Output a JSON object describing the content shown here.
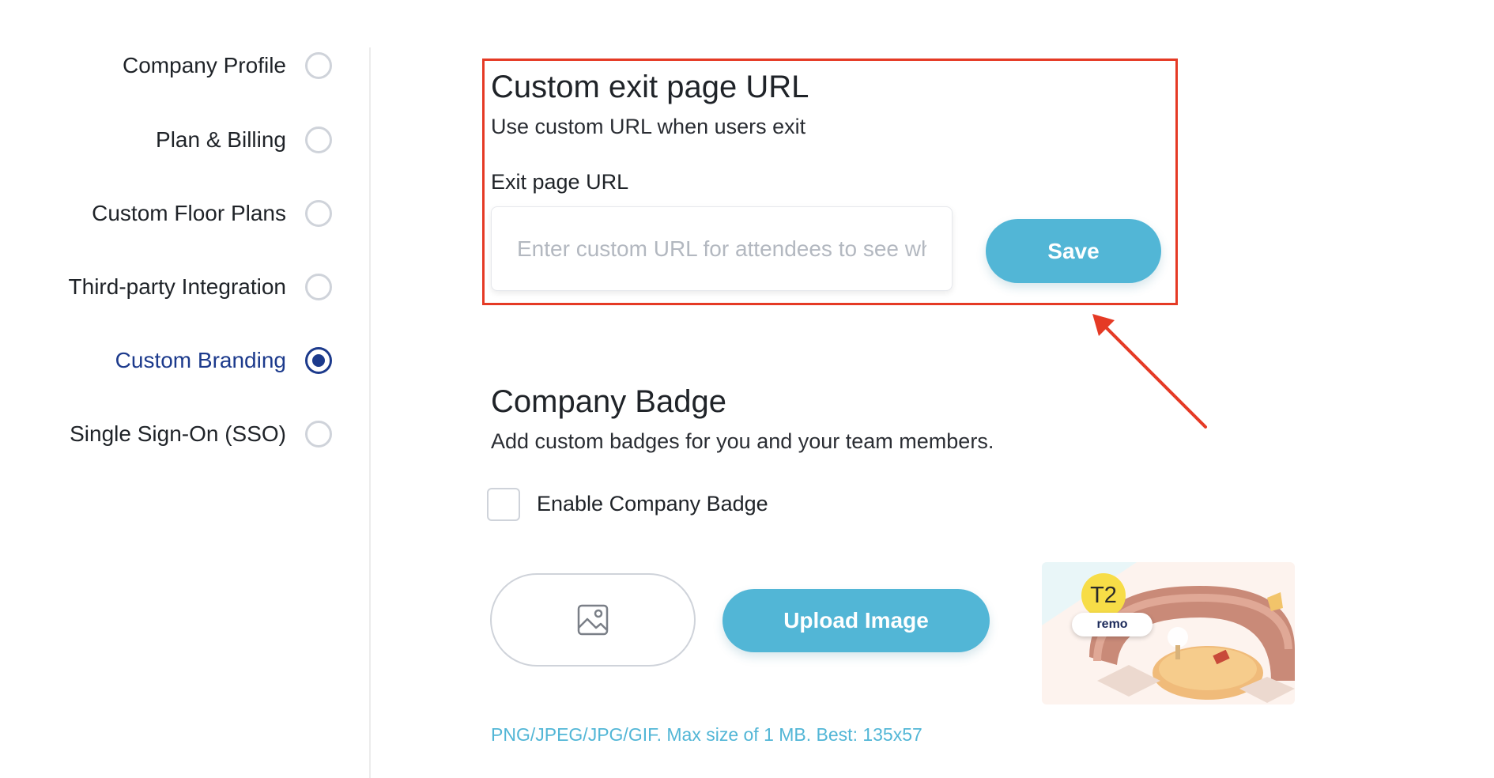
{
  "sidebar": {
    "items": [
      {
        "label": "Company Profile",
        "active": false
      },
      {
        "label": "Plan & Billing",
        "active": false
      },
      {
        "label": "Custom Floor Plans",
        "active": false
      },
      {
        "label": "Third-party Integration",
        "active": false
      },
      {
        "label": "Custom Branding",
        "active": true
      },
      {
        "label": "Single Sign-On (SSO)",
        "active": false
      }
    ]
  },
  "exit_page": {
    "title": "Custom exit page URL",
    "subtitle": "Use custom URL when users exit",
    "field_label": "Exit page URL",
    "input_value": "",
    "input_placeholder": "Enter custom URL for attendees to see when they exit",
    "save_label": "Save"
  },
  "badge": {
    "title": "Company Badge",
    "subtitle": "Add custom badges for you and your team members.",
    "checkbox_label": "Enable Company Badge",
    "checkbox_checked": false,
    "upload_label": "Upload Image",
    "hint": "PNG/JPEG/JPG/GIF. Max size of 1 MB. Best: 135x57",
    "preview": {
      "badge_text": "T2",
      "logo_text": "remo"
    }
  },
  "colors": {
    "accent": "#52b6d6",
    "active_nav": "#1c3a8c",
    "highlight": "#e53a25",
    "badge_yellow": "#f7dd47"
  },
  "icons": {
    "image_placeholder": "image-icon",
    "annotation": "red-arrow"
  }
}
